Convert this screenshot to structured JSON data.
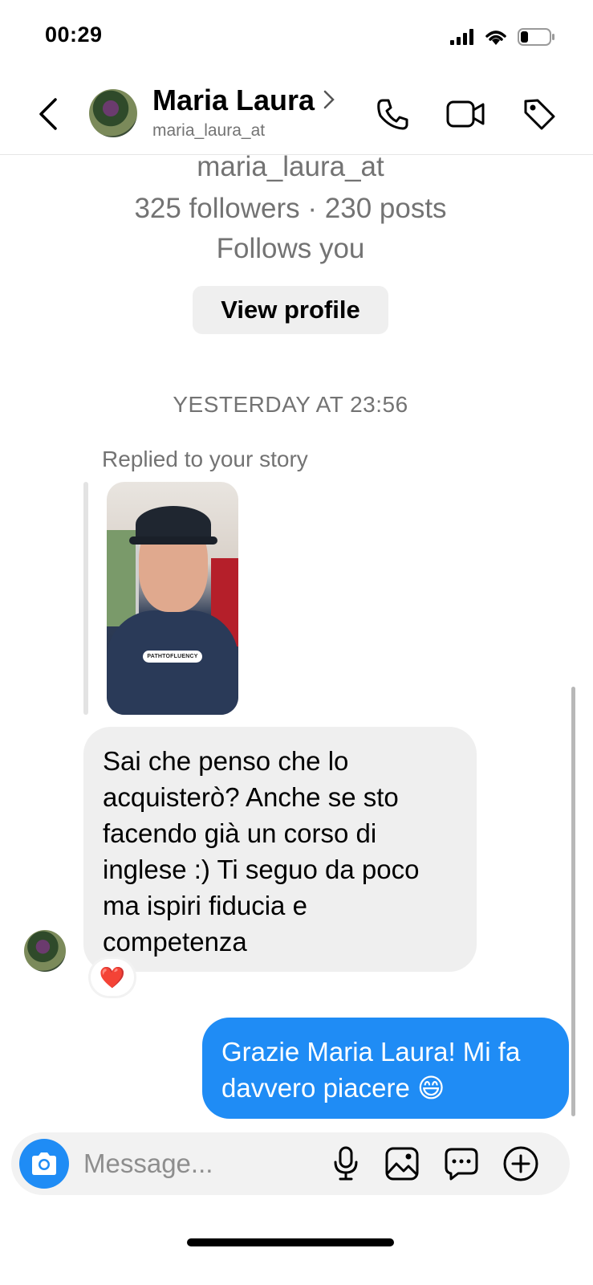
{
  "status_bar": {
    "time": "00:29",
    "battery_level": 0.25
  },
  "header": {
    "name": "Maria Laura",
    "handle": "maria_laura_at",
    "icons": [
      "back-icon",
      "chevron-right-icon",
      "phone-icon",
      "video-camera-icon",
      "tag-icon"
    ]
  },
  "profile": {
    "handle": "maria_laura_at",
    "stats": "325 followers · 230 posts",
    "follows": "Follows you",
    "view_profile": "View profile"
  },
  "conversation": {
    "timestamp": "YESTERDAY AT 23:56",
    "replied_label": "Replied to your story",
    "story_sticker": "PATHTOFLUENCY",
    "received": {
      "text": "Sai che penso che lo acquisterò? Anche se sto facendo già un corso di inglese :) Ti seguo da poco ma ispiri fiducia e competenza",
      "reaction": "❤️"
    },
    "sent": {
      "text": "Grazie Maria Laura! Mi fa davvero piacere 😄"
    }
  },
  "composer": {
    "placeholder": "Message...",
    "icons": [
      "camera-icon",
      "microphone-icon",
      "gallery-icon",
      "sticker-chat-icon",
      "add-icon"
    ]
  },
  "colors": {
    "accent": "#1F8CF5",
    "muted": "#737373",
    "bubble_in": "#EFEFEF"
  }
}
